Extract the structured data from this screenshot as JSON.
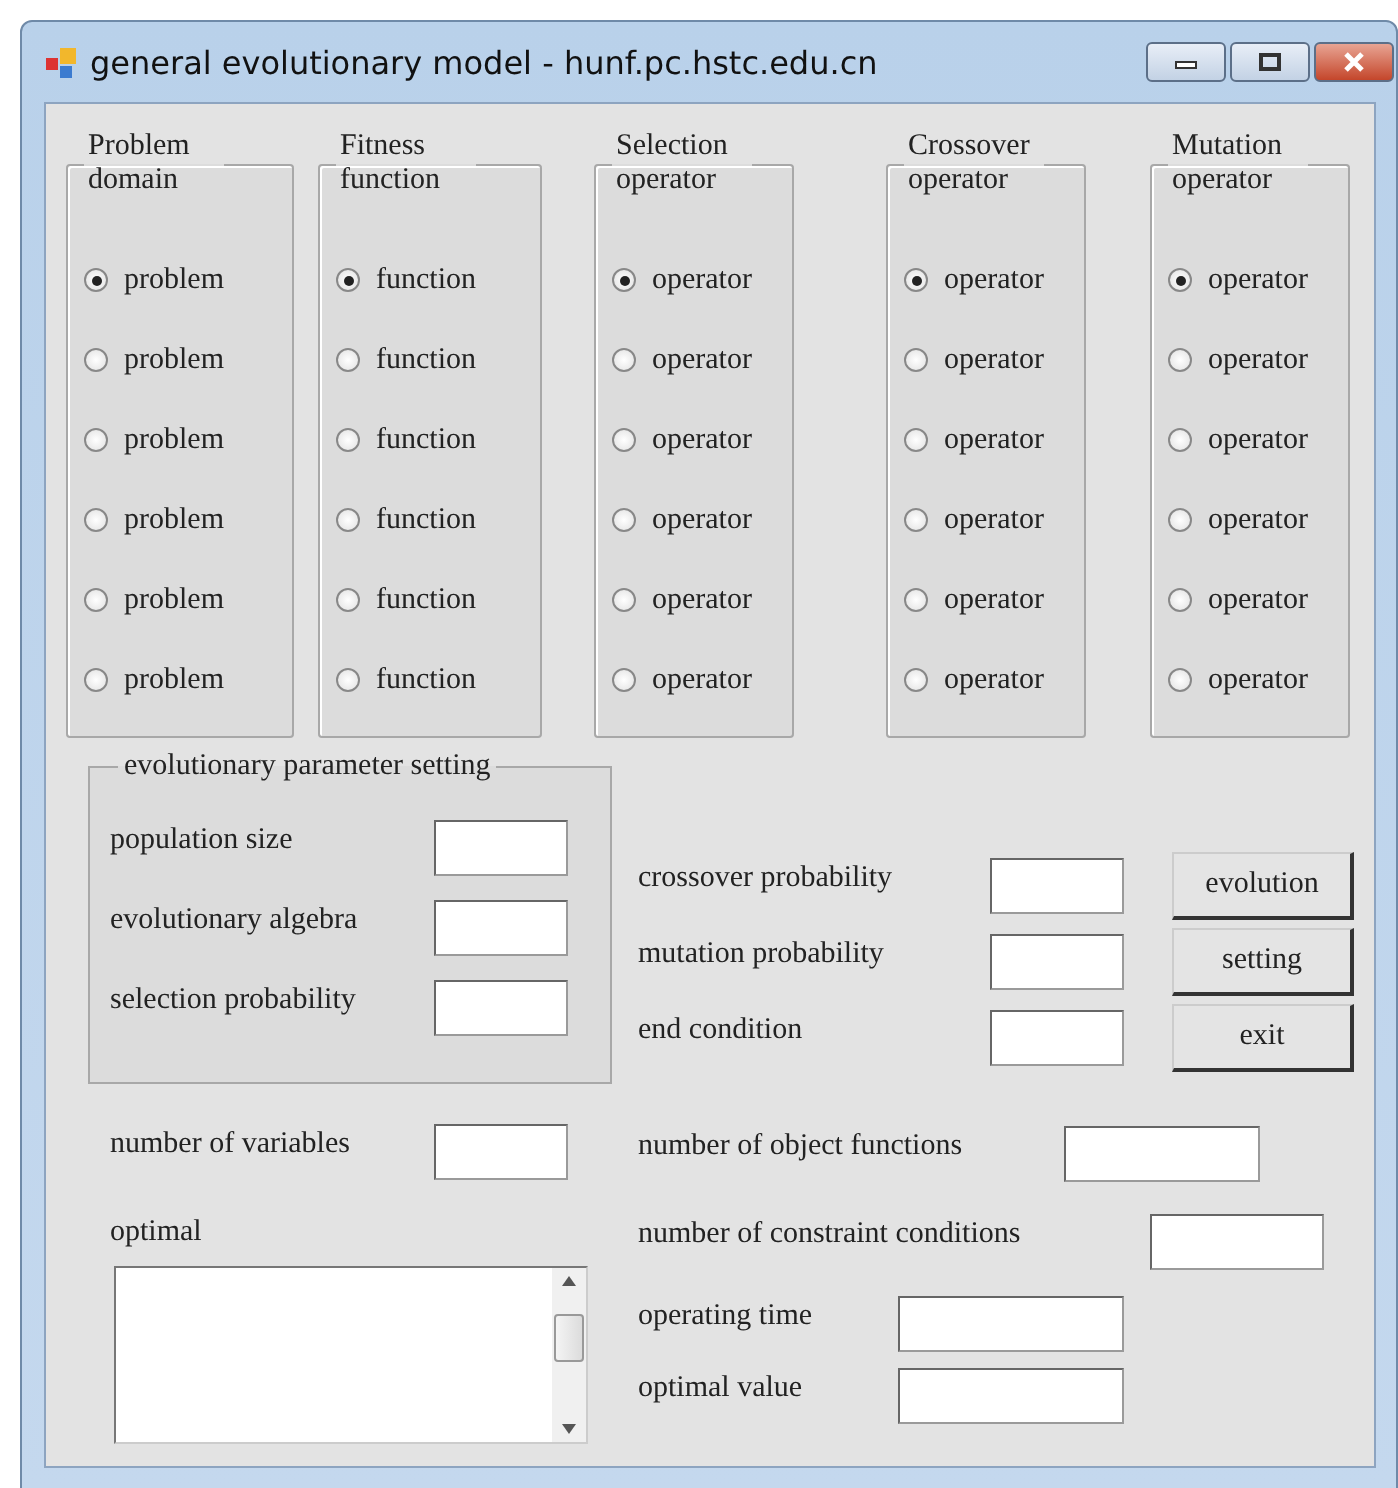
{
  "window": {
    "title": "general evolutionary model - hunf.pc.hstc.edu.cn"
  },
  "option_groups": [
    {
      "title": "Problem domain",
      "options": [
        {
          "label": "problem",
          "selected": true
        },
        {
          "label": "problem",
          "selected": false
        },
        {
          "label": "problem",
          "selected": false
        },
        {
          "label": "problem",
          "selected": false
        },
        {
          "label": "problem",
          "selected": false
        },
        {
          "label": "problem",
          "selected": false
        }
      ]
    },
    {
      "title": "Fitness function",
      "options": [
        {
          "label": "function",
          "selected": true
        },
        {
          "label": "function",
          "selected": false
        },
        {
          "label": "function",
          "selected": false
        },
        {
          "label": "function",
          "selected": false
        },
        {
          "label": "function",
          "selected": false
        },
        {
          "label": "function",
          "selected": false
        }
      ]
    },
    {
      "title": "Selection operator",
      "options": [
        {
          "label": "operator",
          "selected": true
        },
        {
          "label": "operator",
          "selected": false
        },
        {
          "label": "operator",
          "selected": false
        },
        {
          "label": "operator",
          "selected": false
        },
        {
          "label": "operator",
          "selected": false
        },
        {
          "label": "operator",
          "selected": false
        }
      ]
    },
    {
      "title": "Crossover operator",
      "options": [
        {
          "label": "operator",
          "selected": true
        },
        {
          "label": "operator",
          "selected": false
        },
        {
          "label": "operator",
          "selected": false
        },
        {
          "label": "operator",
          "selected": false
        },
        {
          "label": "operator",
          "selected": false
        },
        {
          "label": "operator",
          "selected": false
        }
      ]
    },
    {
      "title": "Mutation operator",
      "options": [
        {
          "label": "operator",
          "selected": true
        },
        {
          "label": "operator",
          "selected": false
        },
        {
          "label": "operator",
          "selected": false
        },
        {
          "label": "operator",
          "selected": false
        },
        {
          "label": "operator",
          "selected": false
        },
        {
          "label": "operator",
          "selected": false
        }
      ]
    }
  ],
  "parameter_group": {
    "title": "evolutionary parameter setting",
    "fields": [
      {
        "label": "population size"
      },
      {
        "label": "evolutionary algebra"
      },
      {
        "label": "selection probability"
      }
    ]
  },
  "probability_fields": [
    {
      "label": "crossover probability"
    },
    {
      "label": "mutation probability"
    },
    {
      "label": "end condition"
    }
  ],
  "buttons": [
    "evolution",
    "setting",
    "exit"
  ],
  "variables_field": {
    "label": "number of variables"
  },
  "optimal": {
    "label": "optimal"
  },
  "result_fields": [
    {
      "label": "number of object functions"
    },
    {
      "label": "number of constraint conditions"
    },
    {
      "label": "operating time"
    },
    {
      "label": "optimal value"
    }
  ]
}
